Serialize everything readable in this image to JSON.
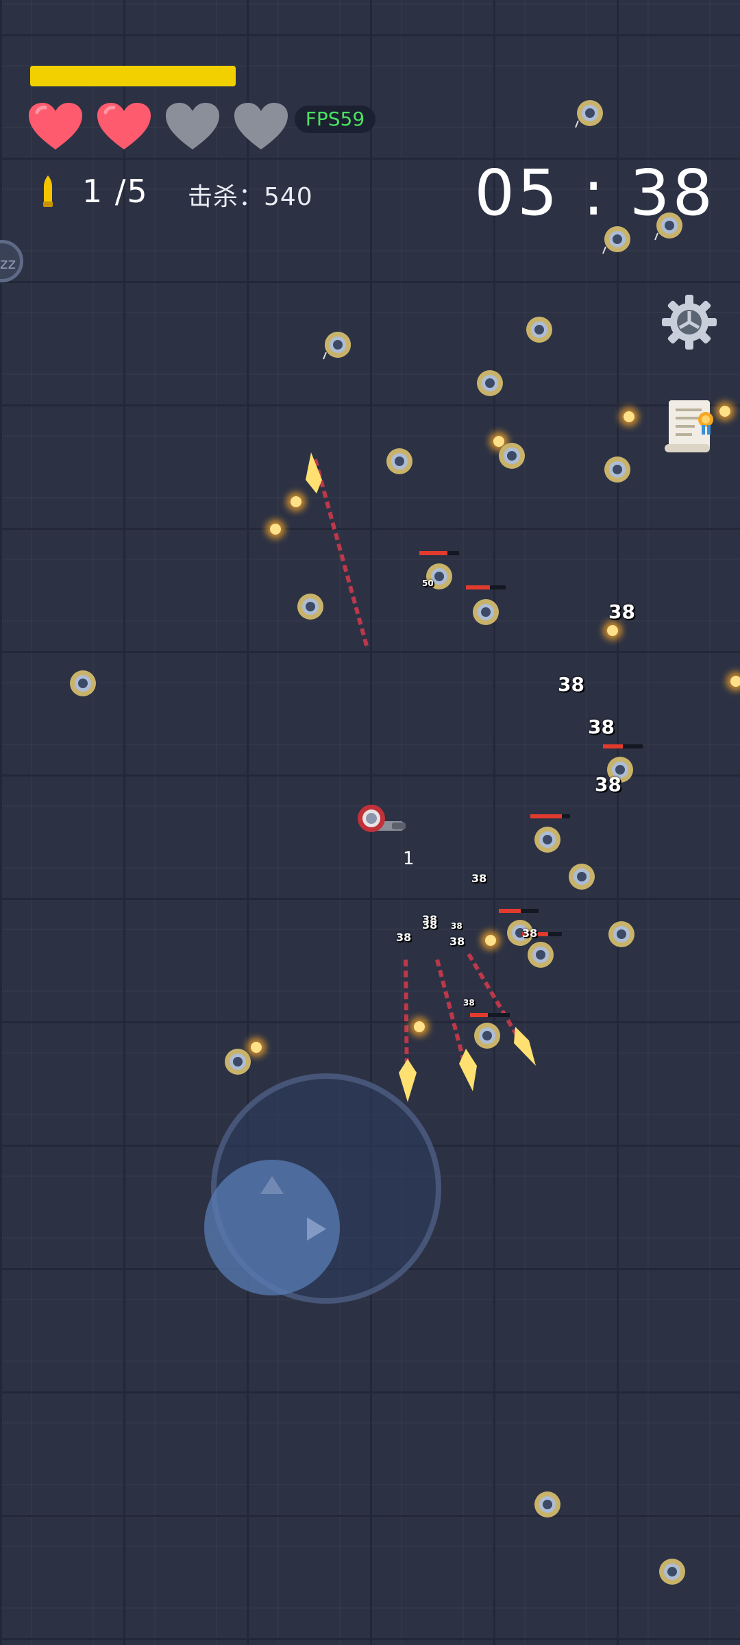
{
  "hud": {
    "xp_progress": 1.0,
    "hearts": [
      {
        "state": "full",
        "color": "#ff5b6e"
      },
      {
        "state": "full",
        "color": "#ff5b6e"
      },
      {
        "state": "empty",
        "color": "#8a8f99"
      },
      {
        "state": "empty",
        "color": "#8a8f99"
      }
    ],
    "fps_label": "FPS59",
    "ammo_text": "1 /5",
    "kills_text": "击杀：540",
    "timer": "05 : 38"
  },
  "buttons": {
    "sleep_label": "zz",
    "settings_icon": "gear-icon",
    "quest_icon": "scroll-icon"
  },
  "player": {
    "label": "1"
  },
  "damage_numbers": [
    "38",
    "38",
    "38",
    "38",
    "38",
    "38",
    "38",
    "38",
    "38",
    "38",
    "38",
    "38",
    "50"
  ],
  "colors": {
    "floor": "#2c3244",
    "xp_bar": "#f2d000",
    "fps_text": "#4be061",
    "bullet_glow": "#ffb020"
  }
}
